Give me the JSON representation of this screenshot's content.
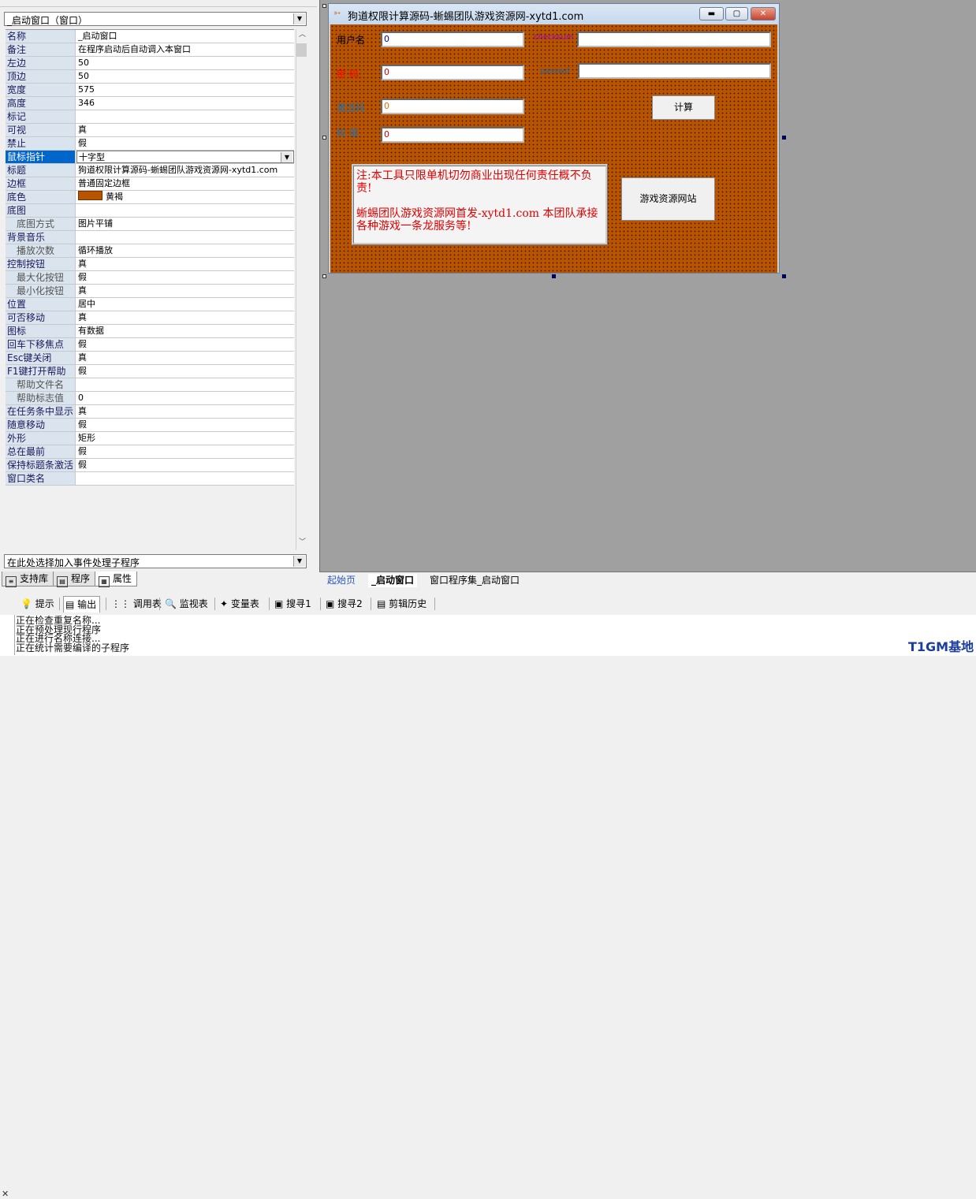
{
  "object_combo": {
    "value": "_启动窗口（窗口）"
  },
  "properties": [
    {
      "name": "名称",
      "value": "_启动窗口"
    },
    {
      "name": "备注",
      "value": "在程序启动后自动调入本窗口"
    },
    {
      "name": "左边",
      "value": "50"
    },
    {
      "name": "顶边",
      "value": "50"
    },
    {
      "name": "宽度",
      "value": "575"
    },
    {
      "name": "高度",
      "value": "346"
    },
    {
      "name": "标记",
      "value": ""
    },
    {
      "name": "可视",
      "value": "真"
    },
    {
      "name": "禁止",
      "value": "假"
    },
    {
      "name": "鼠标指针",
      "value": "十字型"
    },
    {
      "name": "标题",
      "value": "狗道权限计算源码-蜥蜴团队游戏资源网-xytd1.com"
    },
    {
      "name": "边框",
      "value": "普通固定边框"
    },
    {
      "name": "底色",
      "value": "黄褐"
    },
    {
      "name": "底图",
      "value": ""
    },
    {
      "name": "底图方式",
      "value": "图片平铺"
    },
    {
      "name": "背景音乐",
      "value": ""
    },
    {
      "name": "播放次数",
      "value": "循环播放"
    },
    {
      "name": "控制按钮",
      "value": "真"
    },
    {
      "name": "最大化按钮",
      "value": "假"
    },
    {
      "name": "最小化按钮",
      "value": "真"
    },
    {
      "name": "位置",
      "value": "居中"
    },
    {
      "name": "可否移动",
      "value": "真"
    },
    {
      "name": "图标",
      "value": "有数据"
    },
    {
      "name": "回车下移焦点",
      "value": "假"
    },
    {
      "name": "Esc键关闭",
      "value": "真"
    },
    {
      "name": "F1键打开帮助",
      "value": "假"
    },
    {
      "name": "帮助文件名",
      "value": ""
    },
    {
      "name": "帮助标志值",
      "value": "0"
    },
    {
      "name": "在任务条中显示",
      "value": "真"
    },
    {
      "name": "随意移动",
      "value": "假"
    },
    {
      "name": "外形",
      "value": "矩形"
    },
    {
      "name": "总在最前",
      "value": "假"
    },
    {
      "name": "保持标题条激活",
      "value": "假"
    },
    {
      "name": "窗口类名",
      "value": ""
    }
  ],
  "colors": {
    "form_background": "#b85400",
    "notice_text": "#e00000",
    "selected_row": "#0066cc"
  },
  "event_combo": {
    "value": "在此处选择加入事件处理子程序"
  },
  "left_tabs": [
    "支持库",
    "程序",
    "属性"
  ],
  "form": {
    "title": "狗道权限计算源码-蜥蜴团队游戏资源网-xytd1.com",
    "labels": {
      "username": "用户名",
      "password": "密  码",
      "checksum": "checksum",
      "passwd": "passwd",
      "code": "激活码",
      "permission": "权  限"
    },
    "fields": {
      "username": "0",
      "password": "0",
      "code": "0",
      "permission": "0",
      "checksum": "",
      "passwd": ""
    },
    "buttons": {
      "calc": "计算",
      "site": "游戏资源网站"
    },
    "notice_line1": "注:本工具只限单机切勿商业出现任何责任概不负责!",
    "notice_line2": "蜥蜴团队游戏资源网首发-xytd1.com  本团队承接各种游戏一条龙服务等!"
  },
  "design_tabs": [
    "起始页",
    "_启动窗口",
    "窗口程序集_启动窗口"
  ],
  "bottom_tabs": [
    "提示",
    "输出",
    "调用表",
    "监视表",
    "变量表",
    "搜寻1",
    "搜寻2",
    "剪辑历史"
  ],
  "output_lines": [
    "正在检查重复名称...",
    "正在预处理现行程序",
    "正在进行名称连接...",
    "正在统计需要编译的子程序"
  ],
  "watermark": "T1GM基地"
}
